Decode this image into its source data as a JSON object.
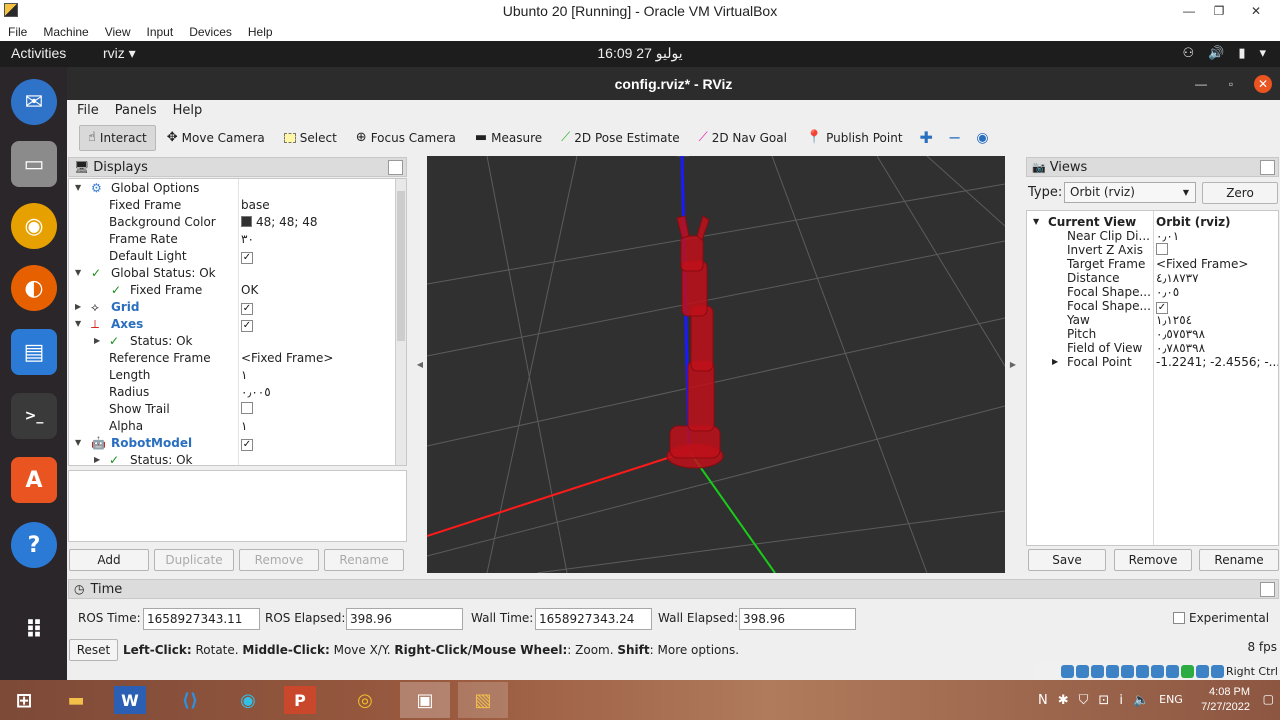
{
  "vbox": {
    "title": "Ubunto 20 [Running] - Oracle VM VirtualBox",
    "menu": [
      "File",
      "Machine",
      "View",
      "Input",
      "Devices",
      "Help"
    ],
    "status_right": "Right Ctrl"
  },
  "gnome": {
    "activities": "Activities",
    "app_menu": "rviz ▾",
    "clock": "16:09  27 يوليو"
  },
  "rviz": {
    "title": "config.rviz* - RViz",
    "menu": [
      "File",
      "Panels",
      "Help"
    ],
    "toolbar": {
      "interact": "Interact",
      "move_camera": "Move Camera",
      "select": "Select",
      "focus_camera": "Focus Camera",
      "measure": "Measure",
      "pose_estimate": "2D Pose Estimate",
      "nav_goal": "2D Nav Goal",
      "publish_point": "Publish Point"
    },
    "displays": {
      "title": "Displays",
      "rows": {
        "global_options": "Global Options",
        "fixed_frame_label": "Fixed Frame",
        "fixed_frame_value": "base",
        "bg_color_label": "Background Color",
        "bg_color_value": "48; 48; 48",
        "frame_rate_label": "Frame Rate",
        "frame_rate_value": "٣٠",
        "default_light_label": "Default Light",
        "global_status": "Global Status: Ok",
        "gs_fixed_frame": "Fixed Frame",
        "gs_fixed_frame_value": "OK",
        "grid": "Grid",
        "axes": "Axes",
        "axes_status": "Status: Ok",
        "ref_frame_label": "Reference Frame",
        "ref_frame_value": "<Fixed Frame>",
        "length_label": "Length",
        "length_value": "١",
        "radius_label": "Radius",
        "radius_value": "٠٫٠٠٥",
        "show_trail_label": "Show Trail",
        "alpha_label": "Alpha",
        "alpha_value": "١",
        "robot_model": "RobotModel",
        "robot_status": "Status: Ok"
      },
      "buttons": {
        "add": "Add",
        "duplicate": "Duplicate",
        "remove": "Remove",
        "rename": "Rename"
      }
    },
    "views": {
      "title": "Views",
      "type_label": "Type:",
      "type_value": "Orbit (rviz)",
      "zero": "Zero",
      "current_view": "Current View",
      "current_view_value": "Orbit (rviz)",
      "props": [
        {
          "label": "Near Clip Di...",
          "value": "٠٫٠١"
        },
        {
          "label": "Invert Z Axis",
          "value": ""
        },
        {
          "label": "Target Frame",
          "value": "<Fixed Frame>"
        },
        {
          "label": "Distance",
          "value": "٤٫١٨٧٣٧"
        },
        {
          "label": "Focal Shape...",
          "value": "٠٫٠٥"
        },
        {
          "label": "Focal Shape...",
          "value": ""
        },
        {
          "label": "Yaw",
          "value": "١٫١٢٥٤"
        },
        {
          "label": "Pitch",
          "value": "٠٫٥٧٥٣٩٨"
        },
        {
          "label": "Field of View",
          "value": "٠٫٧٨٥٣٩٨"
        },
        {
          "label": "Focal Point",
          "value": "-1.2241; -2.4556; -..."
        }
      ],
      "buttons": {
        "save": "Save",
        "remove": "Remove",
        "rename": "Rename"
      }
    },
    "time": {
      "title": "Time",
      "ros_time_label": "ROS Time:",
      "ros_time_value": "1658927343.11",
      "ros_elapsed_label": "ROS Elapsed:",
      "ros_elapsed_value": "398.96",
      "wall_time_label": "Wall Time:",
      "wall_time_value": "1658927343.24",
      "wall_elapsed_label": "Wall Elapsed:",
      "wall_elapsed_value": "398.96",
      "experimental": "Experimental",
      "reset": "Reset",
      "fps": "8 fps",
      "help": {
        "left_b": "Left-Click:",
        "left": " Rotate. ",
        "middle_b": "Middle-Click:",
        "middle": " Move X/Y. ",
        "right_b": "Right-Click/Mouse Wheel:",
        "right": ": Zoom. ",
        "shift_b": "Shift",
        "shift": ": More options."
      }
    }
  },
  "taskbar": {
    "lang": "ENG",
    "time": "4:08 PM",
    "date": "7/27/2022"
  }
}
